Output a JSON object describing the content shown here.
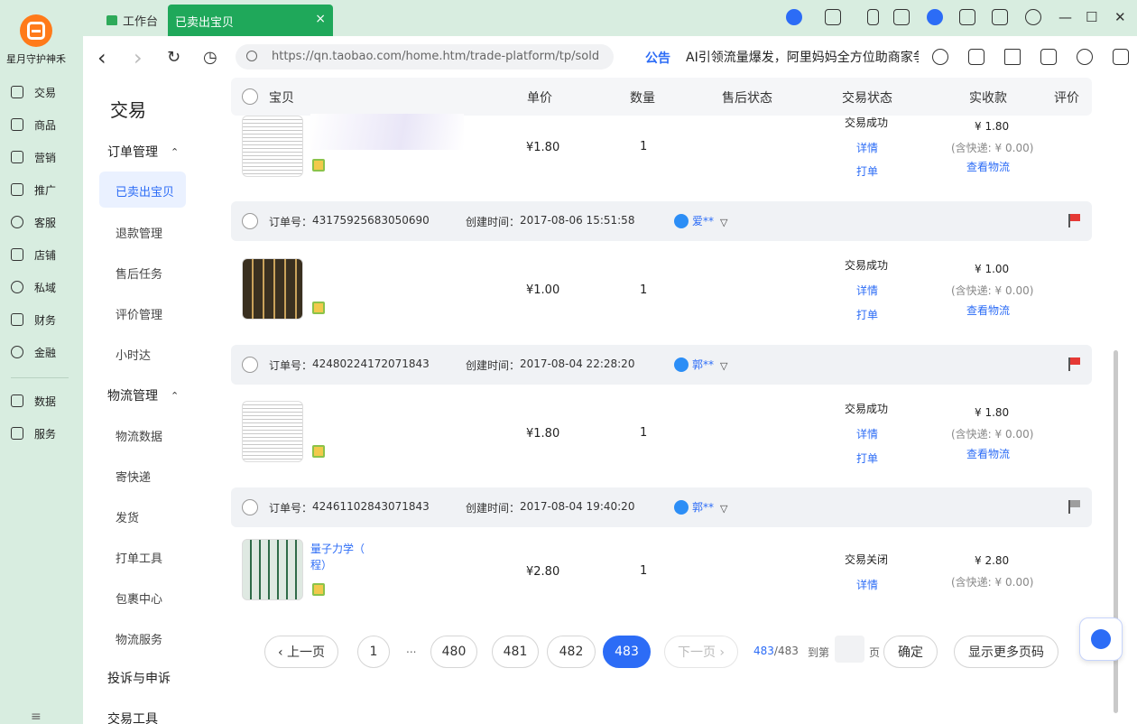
{
  "app": {
    "name": "星月守护神禾"
  },
  "left_rail": {
    "items": [
      {
        "label": "交易",
        "icon": "trade-icon"
      },
      {
        "label": "商品",
        "icon": "goods-icon"
      },
      {
        "label": "营销",
        "icon": "marketing-icon"
      },
      {
        "label": "推广",
        "icon": "promotion-icon"
      },
      {
        "label": "客服",
        "icon": "service-icon"
      },
      {
        "label": "店铺",
        "icon": "shop-icon"
      },
      {
        "label": "私域",
        "icon": "private-domain-icon"
      },
      {
        "label": "财务",
        "icon": "finance-icon"
      },
      {
        "label": "金融",
        "icon": "banking-icon"
      },
      {
        "label": "数据",
        "icon": "data-icon"
      },
      {
        "label": "服务",
        "icon": "services-icon"
      }
    ],
    "bottom": "≡"
  },
  "tabs": {
    "home": "工作台",
    "active": "已卖出宝贝",
    "close": "×"
  },
  "window": {
    "minimize": "—",
    "maximize": "☐",
    "close": "✕"
  },
  "addressbar": {
    "back": "‹",
    "forward": "›",
    "reload": "↻",
    "history": "◷",
    "url": "https://qn.taobao.com/home.htm/trade-platform/tp/sold",
    "notice_label": "公告",
    "notice_text": "AI引领流量爆发，阿里妈妈全方位助商家争"
  },
  "subnav": {
    "title": "交易",
    "groups": [
      {
        "label": "订单管理",
        "items": [
          "已卖出宝贝",
          "退款管理",
          "售后任务",
          "评价管理",
          "小时达"
        ]
      },
      {
        "label": "物流管理",
        "items": [
          "物流数据",
          "寄快递",
          "发货",
          "打单工具",
          "包裹中心",
          "物流服务"
        ]
      },
      {
        "label": "投诉与申诉",
        "items": []
      },
      {
        "label": "交易工具",
        "items": []
      }
    ],
    "chevron": "⌃"
  },
  "table": {
    "headers": {
      "item": "宝贝",
      "price": "单价",
      "qty": "数量",
      "after_sale": "售后状态",
      "status": "交易状态",
      "received": "实收款",
      "review": "评价"
    }
  },
  "labels": {
    "order_no": "订单号：",
    "created": "创建时间：",
    "detail": "详情",
    "print": "打单",
    "logistics": "查看物流"
  },
  "orders": [
    {
      "order_no": "",
      "created": "",
      "buyer": "",
      "item_name": "",
      "price": "¥1.80",
      "qty": "1",
      "status": "交易成功",
      "amount": "¥ 1.80",
      "shipping": "(含快递: ¥ 0.00)",
      "flag": "",
      "has_print": true,
      "has_logistics": true
    },
    {
      "order_no": "43175925683050690",
      "created": "2017-08-06 15:51:58",
      "buyer": "爱**",
      "item_name": "",
      "price": "¥1.00",
      "qty": "1",
      "status": "交易成功",
      "amount": "¥ 1.00",
      "shipping": "(含快递: ¥ 0.00)",
      "flag": "#e53935",
      "has_print": true,
      "has_logistics": true
    },
    {
      "order_no": "42480224172071843",
      "created": "2017-08-04 22:28:20",
      "buyer": "郭**",
      "item_name": "",
      "price": "¥1.80",
      "qty": "1",
      "status": "交易成功",
      "amount": "¥ 1.80",
      "shipping": "(含快递: ¥ 0.00)",
      "flag": "#e53935",
      "has_print": true,
      "has_logistics": true
    },
    {
      "order_no": "42461102843071843",
      "created": "2017-08-04 19:40:20",
      "buyer": "郭**",
      "item_name": "量子力学（",
      "item_name_2": "程）",
      "price": "¥2.80",
      "qty": "1",
      "status": "交易关闭",
      "amount": "¥ 2.80",
      "shipping": "(含快递: ¥ 0.00)",
      "flag": "#9e9e9e",
      "has_print": false,
      "has_logistics": false
    }
  ],
  "pagination": {
    "prev": "‹ 上一页",
    "pages": [
      "1",
      "...",
      "480",
      "481",
      "482",
      "483"
    ],
    "current": "483",
    "next": "下一页 ›",
    "current_of": "483",
    "total_suffix": "/483",
    "goto_label": "到第",
    "page_unit": "页",
    "confirm": "确定",
    "more": "显示更多页码"
  },
  "colors": {
    "accent": "#2c6cf6",
    "tab_active": "#1fa85a",
    "rail_bg": "#d8ede0",
    "flag_red": "#e53935",
    "flag_gray": "#9e9e9e"
  }
}
